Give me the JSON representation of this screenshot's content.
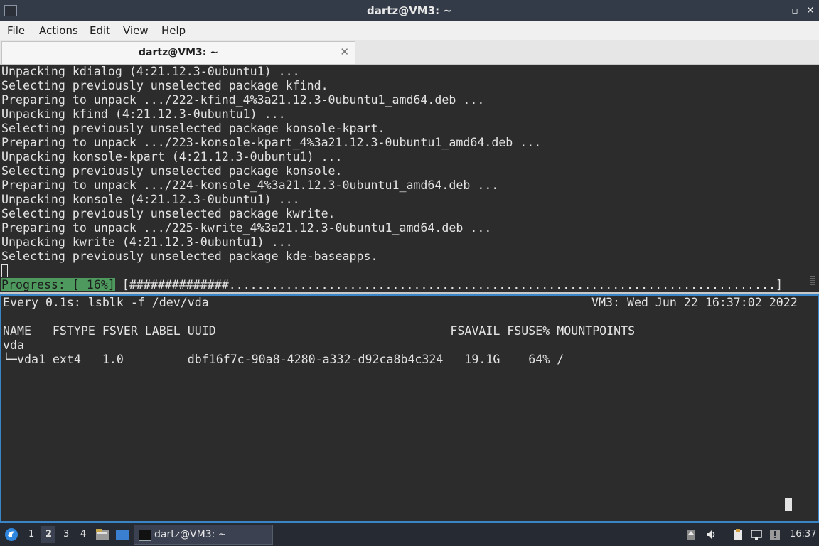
{
  "window": {
    "title": "dartz@VM3: ~",
    "min_icon": "⎯",
    "max_icon": "▫",
    "close_icon": "✕"
  },
  "menu": {
    "items": [
      "File",
      "Actions",
      "Edit",
      "View",
      "Help"
    ]
  },
  "tab": {
    "label": "dartz@VM3: ~",
    "close_icon": "✕"
  },
  "top_terminal": {
    "lines": [
      "Unpacking kdialog (4:21.12.3-0ubuntu1) ...",
      "Selecting previously unselected package kfind.",
      "Preparing to unpack .../222-kfind_4%3a21.12.3-0ubuntu1_amd64.deb ...",
      "Unpacking kfind (4:21.12.3-0ubuntu1) ...",
      "Selecting previously unselected package konsole-kpart.",
      "Preparing to unpack .../223-konsole-kpart_4%3a21.12.3-0ubuntu1_amd64.deb ...",
      "Unpacking konsole-kpart (4:21.12.3-0ubuntu1) ...",
      "Selecting previously unselected package konsole.",
      "Preparing to unpack .../224-konsole_4%3a21.12.3-0ubuntu1_amd64.deb ...",
      "Unpacking konsole (4:21.12.3-0ubuntu1) ...",
      "Selecting previously unselected package kwrite.",
      "Preparing to unpack .../225-kwrite_4%3a21.12.3-0ubuntu1_amd64.deb ...",
      "Unpacking kwrite (4:21.12.3-0ubuntu1) ...",
      "Selecting previously unselected package kde-baseapps."
    ],
    "progress_label": "Progress: [ 16%]",
    "progress_bar": "[##############.............................................................................]",
    "progress_percent": 16
  },
  "bottom_terminal": {
    "watch_header": "Every 0.1s: lsblk -f /dev/vda",
    "watch_status": "VM3: Wed Jun 22 16:37:02 2022",
    "table_header": "NAME   FSTYPE FSVER LABEL UUID                                 FSAVAIL FSUSE% MOUNTPOINTS",
    "rows": [
      "vda",
      "└─vda1 ext4   1.0         dbf16f7c-90a8-4280-a332-d92ca8b4c324   19.1G    64% /"
    ]
  },
  "taskbar": {
    "start_icon": "start-menu-icon",
    "workspaces": [
      "1",
      "2",
      "3",
      "4"
    ],
    "active_workspace": "2",
    "task_label": "dartz@VM3: ~",
    "clock": "16:37",
    "tray_icons": [
      "update-icon",
      "volume-icon",
      "clipboard-icon",
      "network-icon",
      "notification-icon"
    ],
    "accent": "#3a85c8"
  }
}
